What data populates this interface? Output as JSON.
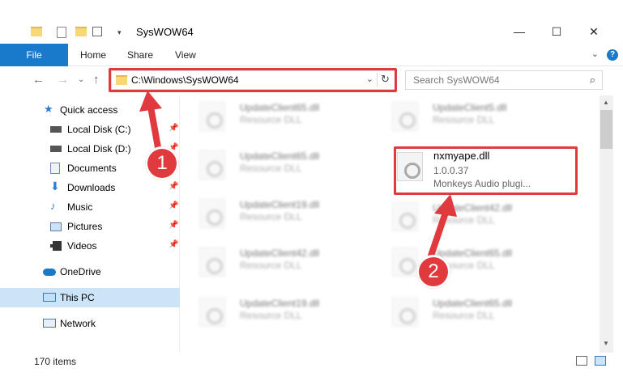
{
  "window": {
    "title": "SysWOW64",
    "minimize_glyph": "—",
    "maximize_glyph": "☐",
    "close_glyph": "✕"
  },
  "ribbon": {
    "file": "File",
    "tabs": [
      "Home",
      "Share",
      "View"
    ],
    "help_glyph": "?"
  },
  "address": {
    "path": "C:\\Windows\\SysWOW64",
    "search_placeholder": "Search SysWOW64"
  },
  "sidebar": {
    "items": [
      {
        "label": "Quick access",
        "icon": "star-icon",
        "pinned": false
      },
      {
        "label": "Local Disk (C:)",
        "icon": "drive-icon",
        "pinned": true
      },
      {
        "label": "Local Disk (D:)",
        "icon": "drive-icon",
        "pinned": true
      },
      {
        "label": "Documents",
        "icon": "documents-icon",
        "pinned": true
      },
      {
        "label": "Downloads",
        "icon": "download-icon",
        "pinned": true
      },
      {
        "label": "Music",
        "icon": "music-icon",
        "pinned": true
      },
      {
        "label": "Pictures",
        "icon": "pictures-icon",
        "pinned": true
      },
      {
        "label": "Videos",
        "icon": "videos-icon",
        "pinned": true
      },
      {
        "label": "OneDrive",
        "icon": "cloud-icon",
        "pinned": false
      },
      {
        "label": "This PC",
        "icon": "computer-icon",
        "pinned": false,
        "selected": true
      },
      {
        "label": "Network",
        "icon": "network-icon",
        "pinned": false
      }
    ]
  },
  "files": [
    {
      "name": "UpdateClient65.dll",
      "desc": "Resource DLL",
      "blurred": true
    },
    {
      "name": "UpdateClient5.dll",
      "desc": "Resource DLL",
      "blurred": true
    },
    {
      "name": "UpdateClient65.dll",
      "desc": "Resource DLL",
      "blurred": true
    },
    {
      "name": "nxmyape.dll",
      "version": "1.0.0.37",
      "desc": "Monkeys Audio plugi...",
      "blurred": false
    },
    {
      "name": "UpdateClient19.dll",
      "desc": "Resource DLL",
      "blurred": true
    },
    {
      "name": "UpdateClient42.dll",
      "desc": "Resource DLL",
      "blurred": true
    },
    {
      "name": "UpdateClient42.dll",
      "desc": "Resource DLL",
      "blurred": true
    },
    {
      "name": "UpdateClient65.dll",
      "desc": "Resource DLL",
      "blurred": true
    },
    {
      "name": "UpdateClient19.dll",
      "desc": "Resource DLL",
      "blurred": true
    },
    {
      "name": "UpdateClient65.dll",
      "desc": "Resource DLL",
      "blurred": true
    }
  ],
  "status": {
    "items_count": "170 items"
  },
  "annotations": {
    "badge_1": "1",
    "badge_2": "2",
    "color": "#e0393e"
  }
}
